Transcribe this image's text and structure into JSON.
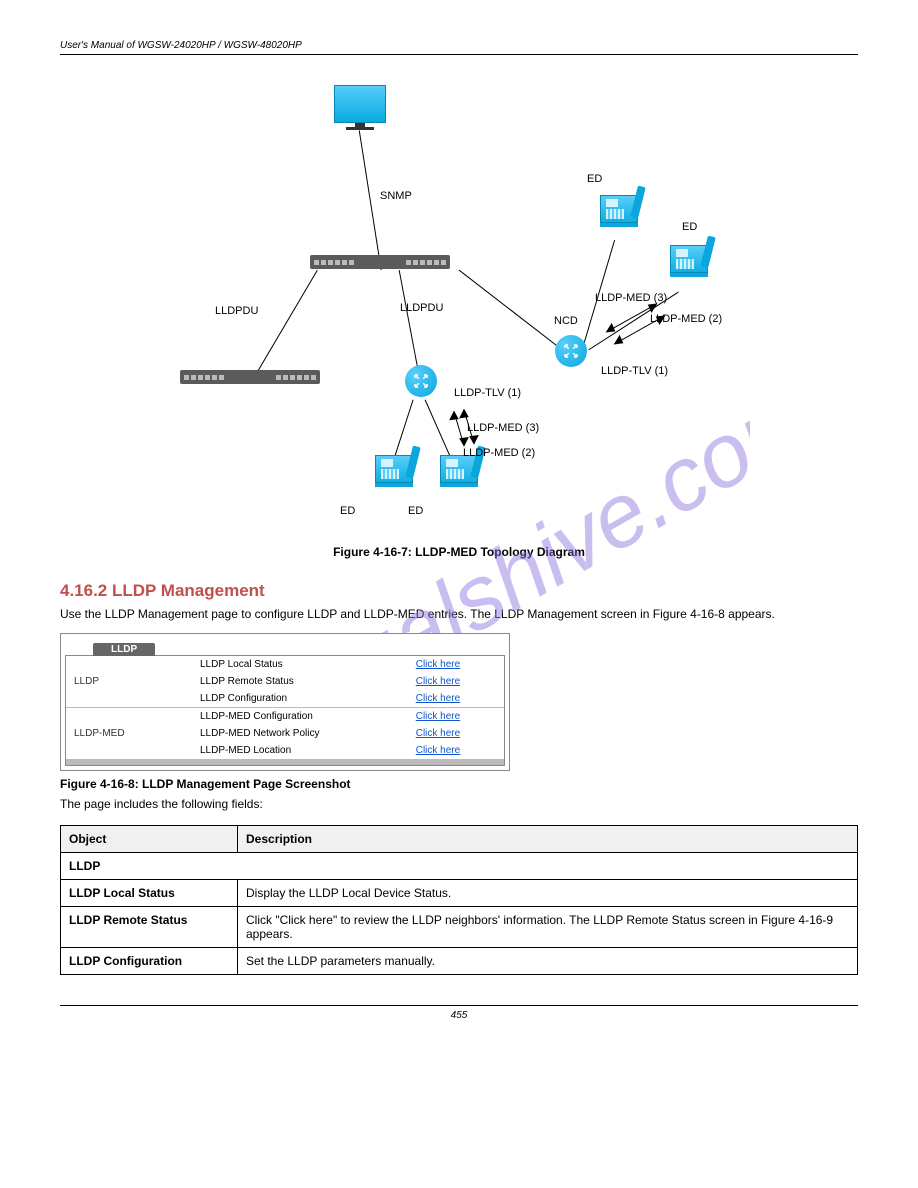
{
  "header": {
    "left": "User's Manual of WGSW-24020HP / WGSW-48020HP",
    "right": ""
  },
  "watermark": "manualshive.com",
  "diagram": {
    "labels": {
      "snmp": "SNMP",
      "lldpdu1": "LLDPDU",
      "lldpdu2": "LLDPDU",
      "ncd": "NCD",
      "tlv1_a": "LLDP-TLV (1)",
      "med2_a": "LLDP-MED (2)",
      "med3_a": "LLDP-MED (3)",
      "ed": "ED",
      "tlv1_b": "LLDP-TLV (1)",
      "med2_b": "LLDP-MED (2)",
      "med3_b": "LLDP-MED (3)"
    }
  },
  "caption1": "Figure 4-16-7: LLDP-MED Topology Diagram",
  "section_title": "4.16.2 LLDP Management",
  "section_body": "Use the LLDP Management page to configure LLDP and LLDP-MED entries. The LLDP Management screen in Figure 4-16-8 appears.",
  "mgmt": {
    "tab": "LLDP",
    "rows": [
      {
        "cat": "LLDP",
        "label": "LLDP Local Status",
        "link": "Click here"
      },
      {
        "cat": "",
        "label": "LLDP Remote Status",
        "link": "Click here"
      },
      {
        "cat": "",
        "label": "LLDP Configuration",
        "link": "Click here"
      },
      {
        "cat": "LLDP-MED",
        "label": "LLDP-MED Configuration",
        "link": "Click here"
      },
      {
        "cat": "",
        "label": "LLDP-MED Network Policy",
        "link": "Click here"
      },
      {
        "cat": "",
        "label": "LLDP-MED Location",
        "link": "Click here"
      }
    ]
  },
  "caption2": "Figure 4-16-8: LLDP Management Page Screenshot",
  "desc_intro": "The page includes the following fields:",
  "desc_table": {
    "head": {
      "c1": "Object",
      "c2": "Description"
    },
    "group1": "LLDP",
    "rows": [
      {
        "f": "LLDP Local Status",
        "d": "Display the LLDP Local Device Status."
      },
      {
        "f": "LLDP Remote Status",
        "d": "Click \"Click here\" to review the LLDP neighbors' information. The LLDP Remote Status screen in Figure 4-16-9 appears."
      },
      {
        "f": "LLDP Configuration",
        "d": "Set the LLDP parameters manually."
      }
    ]
  },
  "footer": "455"
}
